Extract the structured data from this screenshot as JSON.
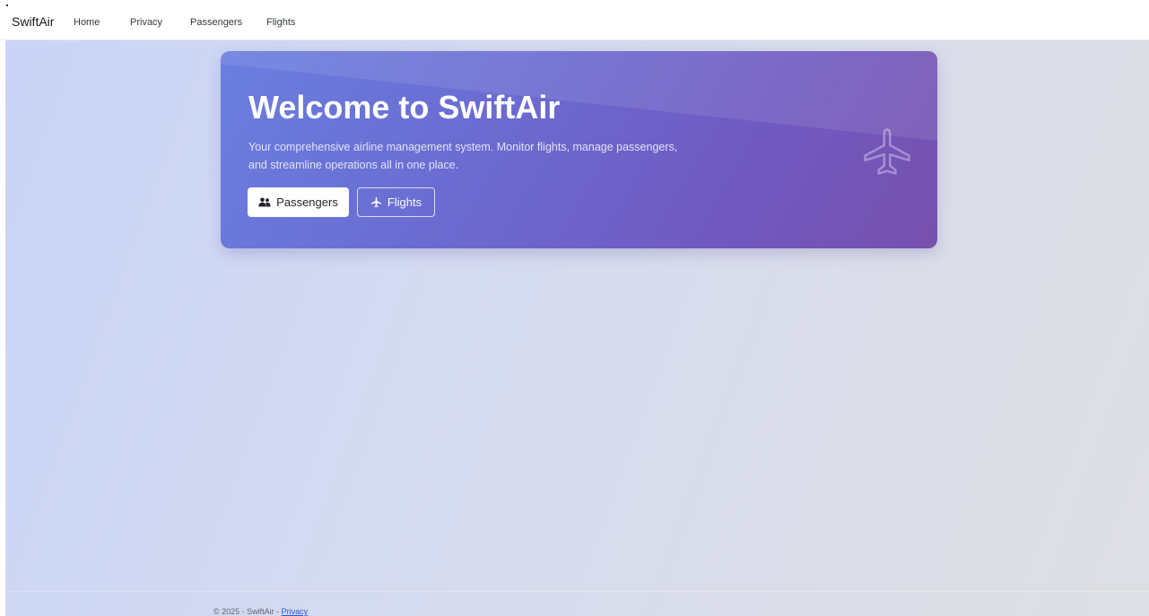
{
  "navbar": {
    "brand": "SwiftAir",
    "links": [
      "Home",
      "Privacy",
      "Passengers",
      "Flights"
    ]
  },
  "hero": {
    "title": "Welcome to SwiftAir",
    "description": "Your comprehensive airline management system. Monitor flights, manage passengers, and streamline operations all in one place.",
    "buttons": {
      "passengers": {
        "label": "Passengers",
        "icon": "users-icon"
      },
      "flights": {
        "label": "Flights",
        "icon": "plane-icon"
      }
    },
    "decoration_icon": "plane-outline-icon"
  },
  "footer": {
    "text": "© 2025 - SwiftAir - ",
    "link": "Privacy"
  },
  "colors": {
    "hero_start": "#6a7fe0",
    "hero_end": "#7750ad",
    "page_bg": "#d3daf1",
    "link": "#2a5bd7"
  }
}
